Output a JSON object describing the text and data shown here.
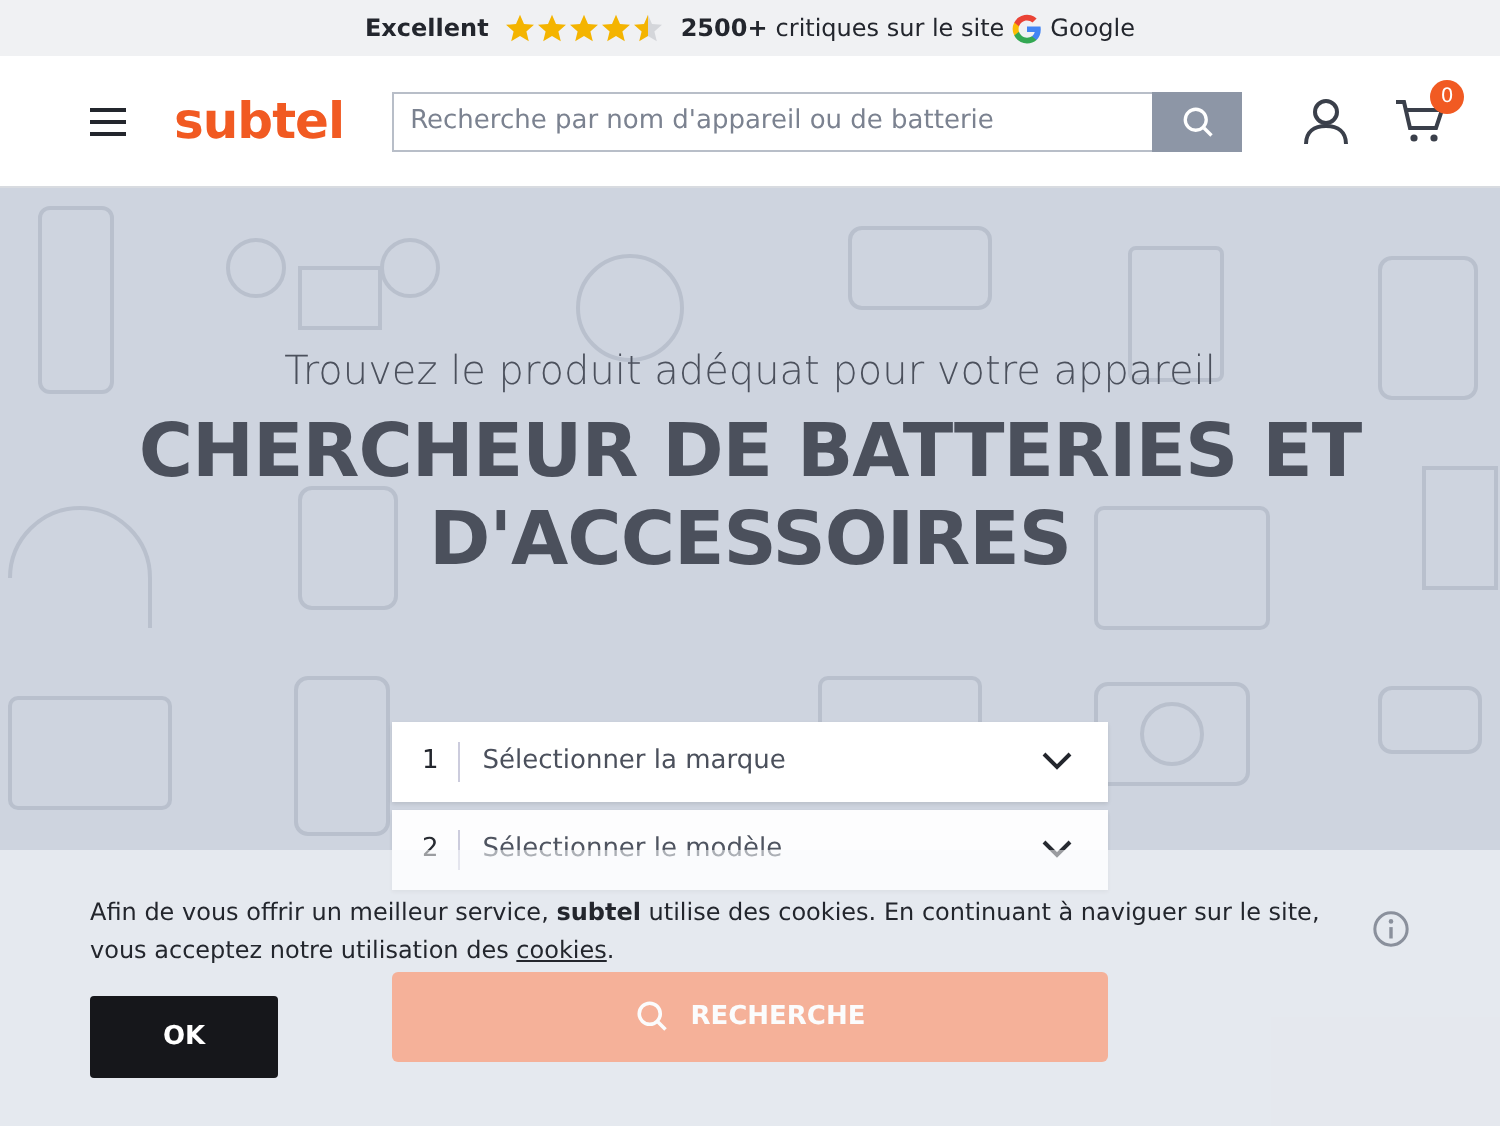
{
  "rating_bar": {
    "label": "Excellent",
    "stars": 4.5,
    "count": "2500+",
    "text": "critiques sur le site",
    "provider": "Google"
  },
  "header": {
    "logo": "subtel",
    "search": {
      "placeholder": "Recherche par nom d'appareil ou de batterie"
    },
    "cart_count": "0"
  },
  "hero": {
    "subtitle": "Trouvez le produit adéquat pour votre appareil",
    "title": "CHERCHEUR DE BATTERIES ET D'ACCESSOIRES",
    "steps": [
      {
        "number": "1",
        "label": "Sélectionner la marque"
      },
      {
        "number": "2",
        "label": "Sélectionner le modèle"
      }
    ],
    "search_button": "RECHERCHE"
  },
  "cookie_banner": {
    "text": "Afin de vous offrir un meilleur service, **subtel** utilise des cookies. En continuant à naviguer sur le site, vous acceptez notre utilisation des",
    "link": "cookies",
    "after_link": ".",
    "button": "OK"
  }
}
